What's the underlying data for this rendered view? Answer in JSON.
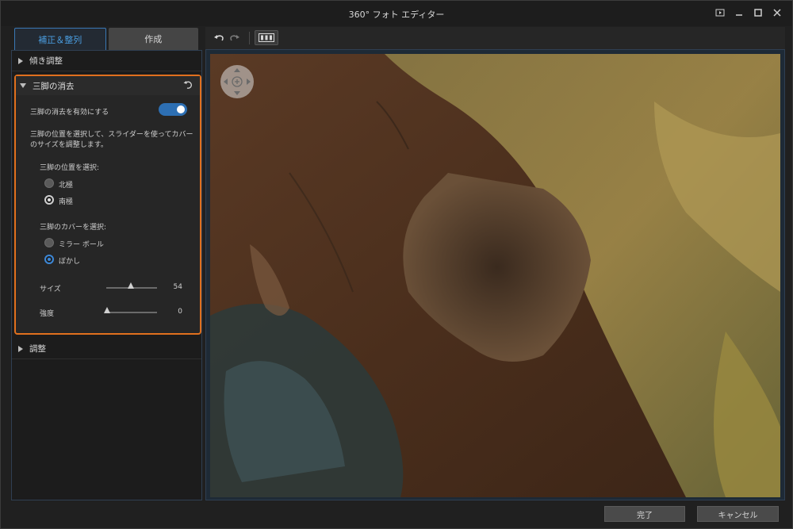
{
  "window": {
    "title": "360° フォト エディター"
  },
  "tabs": [
    {
      "label": "補正＆整列",
      "active": true
    },
    {
      "label": "作成",
      "active": false
    }
  ],
  "sections": {
    "tilt": {
      "label": "傾き調整",
      "expanded": false
    },
    "tripod": {
      "label": "三脚の消去",
      "expanded": true,
      "enable_label": "三脚の消去を有効にする",
      "enabled": true,
      "description": "三脚の位置を選択して、スライダーを使ってカバーのサイズを調整します。",
      "position": {
        "heading": "三脚の位置を選択:",
        "options": [
          "北極",
          "南極"
        ],
        "selected": "南極"
      },
      "cover": {
        "heading": "三脚のカバーを選択:",
        "options": [
          "ミラー ボール",
          "ぼかし"
        ],
        "selected": "ぼかし"
      },
      "size": {
        "label": "サイズ",
        "value": "54"
      },
      "strength": {
        "label": "強度",
        "value": "0"
      }
    },
    "adjust": {
      "label": "調整",
      "expanded": false
    }
  },
  "footer": {
    "done_label": "完了",
    "cancel_label": "キャンセル"
  },
  "icons": [
    "undo-icon",
    "redo-icon",
    "view-mode-icon",
    "reset-icon",
    "navigation-pad-icon",
    "window-help-icon",
    "minimize-icon",
    "maximize-icon",
    "close-icon"
  ],
  "colors": {
    "accent": "#3c87d6",
    "highlight": "#e0701e"
  }
}
